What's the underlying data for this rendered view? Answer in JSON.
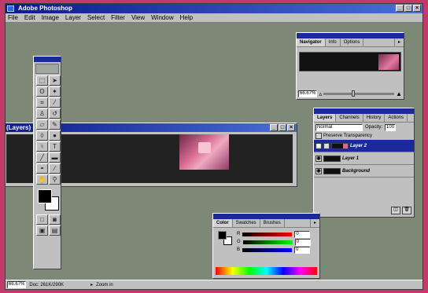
{
  "app": {
    "title": "Adobe Photoshop"
  },
  "menu": [
    "File",
    "Edit",
    "Image",
    "Layer",
    "Select",
    "Filter",
    "View",
    "Window",
    "Help"
  ],
  "document": {
    "title": "(Layers)"
  },
  "navigator": {
    "tabs": [
      "Navigator",
      "Info",
      "Options"
    ],
    "zoom": "66.67%"
  },
  "layers_panel": {
    "tabs": [
      "Layers",
      "Channels",
      "History",
      "Actions"
    ],
    "mode": "Normal",
    "opacity_label": "Opacity:",
    "opacity": "100",
    "preserve": "Preserve Transparency",
    "layers": [
      "Layer 2",
      "Layer 1",
      "Background"
    ],
    "selected": 0
  },
  "color_panel": {
    "tabs": [
      "Color",
      "Swatches",
      "Brushes"
    ],
    "channels": [
      {
        "label": "R",
        "value": "0",
        "gradient": "#ff0000"
      },
      {
        "label": "G",
        "value": "0",
        "gradient": "#00ff00"
      },
      {
        "label": "B",
        "value": "0",
        "gradient": "#0000ff"
      }
    ]
  },
  "status": {
    "zoom": "66.67%",
    "doc": "Doc: 261K/290K",
    "info": "Zoom in"
  },
  "colors": {
    "titlebar": "#0c1a8c",
    "desktop": "#7d8877",
    "frame": "#c23a6a"
  },
  "icons": [
    "marquee-icon",
    "move-icon",
    "lasso-icon",
    "magic-wand-icon",
    "crop-icon",
    "brush-icon",
    "stamp-icon",
    "history-brush-icon",
    "eraser-icon",
    "pencil-icon",
    "blur-icon",
    "dodge-icon",
    "pen-icon",
    "type-icon",
    "line-icon",
    "gradient-icon",
    "paint-bucket-icon",
    "eyedropper-icon",
    "hand-icon",
    "zoom-icon"
  ]
}
